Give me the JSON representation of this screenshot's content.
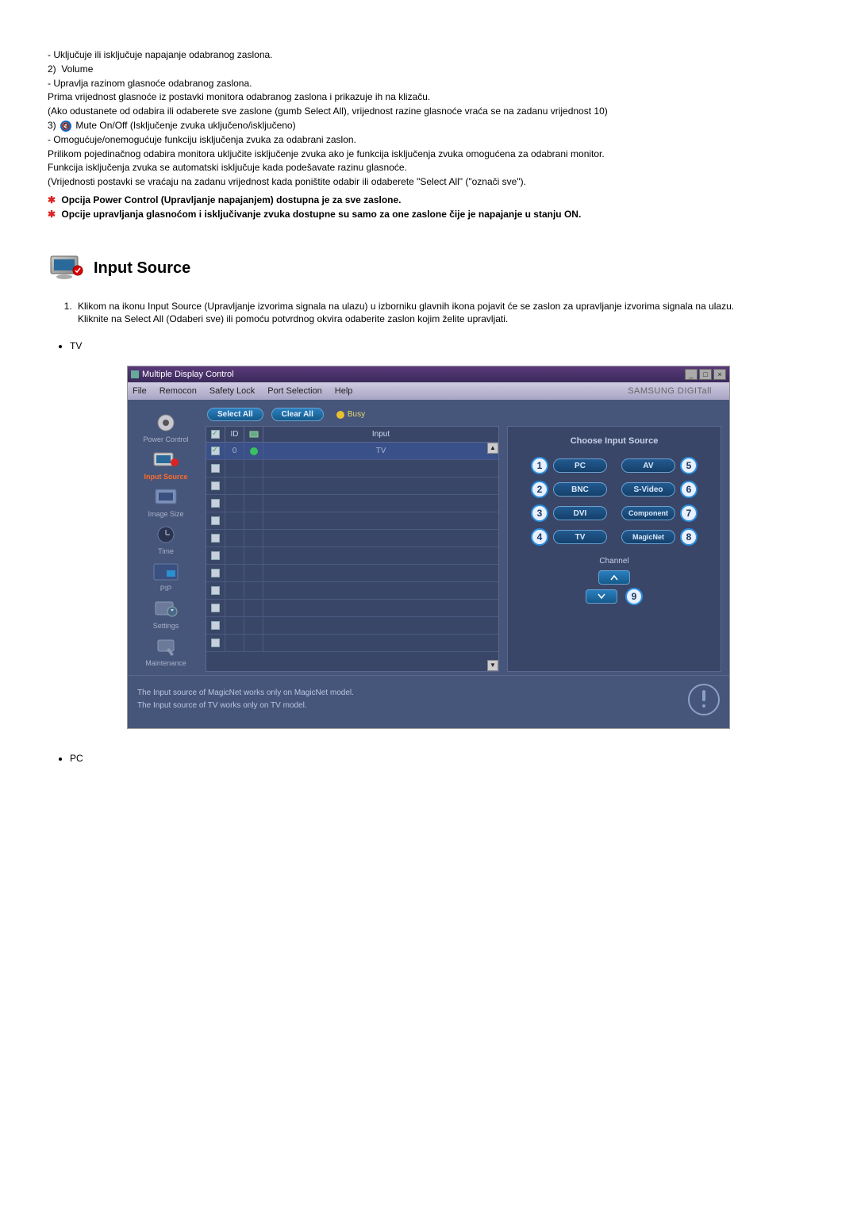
{
  "top": {
    "power_off": "- Uključuje ili isključuje napajanje odabranog zaslona.",
    "vol_num": "2)",
    "volume_label": "Volume",
    "vol_l1": "- Upravlja razinom glasnoće odabranog zaslona.",
    "vol_l2": "Prima vrijednost glasnoće iz postavki monitora odabranog zaslona i prikazuje ih na klizaču.",
    "vol_l3": "(Ako odustanete od odabira ili odaberete sve zaslone (gumb Select All), vrijednost razine glasnoće vraća se na zadanu vrijednost 10)",
    "mute_num": "3)",
    "mute_label": "Mute On/Off (Isključenje zvuka uključeno/isključeno)",
    "mute_l1": "- Omogućuje/onemogućuje funkciju isključenja zvuka za odabrani zaslon.",
    "mute_l2": "Prilikom pojedinačnog odabira monitora uključite isključenje zvuka ako je funkcija isključenja zvuka omogućena za odabrani monitor.",
    "mute_l3": "Funkcija isključenja zvuka se automatski isključuje kada podešavate razinu glasnoće.",
    "mute_l4": "(Vrijednosti postavki se vraćaju na zadanu vrijednost kada poništite odabir ili odaberete \"Select All\" (\"označi sve\").",
    "star1": "Opcija Power Control (Upravljanje napajanjem) dostupna je za sve zaslone.",
    "star2": "Opcije upravljanja glasnoćom i isključivanje zvuka dostupne su samo za one zaslone čije je napajanje u stanju ON."
  },
  "section_title": "Input Source",
  "intro": {
    "li1": "Klikom na ikonu Input Source (Upravljanje izvorima signala na ulazu) u izborniku glavnih ikona pojavit će se zaslon za upravljanje izvorima signala na ulazu.",
    "li1b": "Kliknite na Select All (Odaberi sve) ili pomoću potvrdnog okvira odaberite zaslon kojim želite upravljati.",
    "bullet_tv": "TV",
    "bullet_pc": "PC"
  },
  "app": {
    "title": "Multiple Display Control",
    "menu": {
      "file": "File",
      "remocon": "Remocon",
      "safety": "Safety Lock",
      "port": "Port Selection",
      "help": "Help"
    },
    "brand": "SAMSUNG DIGITall",
    "sidebar": {
      "power": "Power Control",
      "input": "Input Source",
      "image": "Image Size",
      "time": "Time",
      "pip": "PIP",
      "settings": "Settings",
      "maint": "Maintenance"
    },
    "toolbar": {
      "select_all": "Select All",
      "clear_all": "Clear All",
      "busy": "Busy"
    },
    "grid": {
      "h_id": "ID",
      "h_input": "Input",
      "row0_id": "0",
      "row0_input": "TV"
    },
    "right": {
      "title": "Choose Input Source",
      "pc": "PC",
      "av": "AV",
      "bnc": "BNC",
      "svideo": "S-Video",
      "dvi": "DVI",
      "component": "Component",
      "tv": "TV",
      "magicnet": "MagicNet",
      "n1": "1",
      "n2": "2",
      "n3": "3",
      "n4": "4",
      "n5": "5",
      "n6": "6",
      "n7": "7",
      "n8": "8",
      "n9": "9",
      "channel": "Channel"
    },
    "footer": {
      "l1": "The Input source of MagicNet works only on MagicNet model.",
      "l2": "The Input source of TV works only on TV model."
    }
  }
}
